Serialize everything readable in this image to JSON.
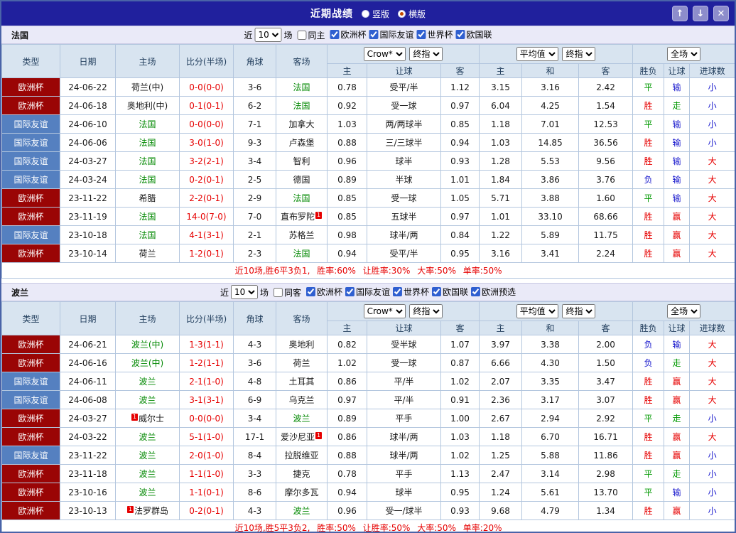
{
  "titlebar": {
    "title": "近期战绩",
    "radios": [
      {
        "label": "竖版",
        "selected": false
      },
      {
        "label": "横版",
        "selected": true
      }
    ],
    "buttons": {
      "up": "↑",
      "down": "↓",
      "close": "✕"
    }
  },
  "table": {
    "static_cols": [
      "类型",
      "日期",
      "主场",
      "比分(半场)",
      "角球",
      "客场"
    ],
    "sub_cols": [
      "主",
      "让球",
      "客",
      "主",
      "和",
      "客",
      "胜负",
      "让球",
      "进球数"
    ],
    "selects": {
      "company": "Crow*",
      "final": "终指",
      "average": "平均值",
      "final2": "终指",
      "scope": "全场"
    }
  },
  "sections": [
    {
      "team": "法国",
      "near_label": "近",
      "count": "10",
      "games_label": "场",
      "same_label": "同主",
      "competitions": [
        "欧洲杯",
        "国际友谊",
        "世界杯",
        "欧国联"
      ],
      "rows": [
        [
          "欧洲杯",
          "24-06-22",
          {
            "t": "荷兰(中)"
          },
          "0-0(0-0)",
          "3-6",
          {
            "t": "法国",
            "g": 1
          },
          "0.78",
          "受平/半",
          "1.12",
          "3.15",
          "3.16",
          "2.42",
          "平",
          "输",
          "小"
        ],
        [
          "欧洲杯",
          "24-06-18",
          {
            "t": "奥地利(中)"
          },
          "0-1(0-1)",
          "6-2",
          {
            "t": "法国",
            "g": 1
          },
          "0.92",
          "受一球",
          "0.97",
          "6.04",
          "4.25",
          "1.54",
          "胜",
          "走",
          "小"
        ],
        [
          "国际友谊",
          "24-06-10",
          {
            "t": "法国",
            "g": 1
          },
          "0-0(0-0)",
          "7-1",
          {
            "t": "加拿大"
          },
          "1.03",
          "两/两球半",
          "0.85",
          "1.18",
          "7.01",
          "12.53",
          "平",
          "输",
          "小"
        ],
        [
          "国际友谊",
          "24-06-06",
          {
            "t": "法国",
            "g": 1
          },
          "3-0(1-0)",
          "9-3",
          {
            "t": "卢森堡"
          },
          "0.88",
          "三/三球半",
          "0.94",
          "1.03",
          "14.85",
          "36.56",
          "胜",
          "输",
          "小"
        ],
        [
          "国际友谊",
          "24-03-27",
          {
            "t": "法国",
            "g": 1
          },
          "3-2(2-1)",
          "3-4",
          {
            "t": "智利"
          },
          "0.96",
          "球半",
          "0.93",
          "1.28",
          "5.53",
          "9.56",
          "胜",
          "输",
          "大"
        ],
        [
          "国际友谊",
          "24-03-24",
          {
            "t": "法国",
            "g": 1
          },
          "0-2(0-1)",
          "2-5",
          {
            "t": "德国"
          },
          "0.89",
          "半球",
          "1.01",
          "1.84",
          "3.86",
          "3.76",
          "负",
          "输",
          "大"
        ],
        [
          "欧洲杯",
          "23-11-22",
          {
            "t": "希腊"
          },
          "2-2(0-1)",
          "2-9",
          {
            "t": "法国",
            "g": 1
          },
          "0.85",
          "受一球",
          "1.05",
          "5.71",
          "3.88",
          "1.60",
          "平",
          "输",
          "大"
        ],
        [
          "欧洲杯",
          "23-11-19",
          {
            "t": "法国",
            "g": 1
          },
          "14-0(7-0)",
          "7-0",
          {
            "t": "直布罗陀",
            "b": "1"
          },
          "0.85",
          "五球半",
          "0.97",
          "1.01",
          "33.10",
          "68.66",
          "胜",
          "赢",
          "大"
        ],
        [
          "国际友谊",
          "23-10-18",
          {
            "t": "法国",
            "g": 1
          },
          "4-1(3-1)",
          "2-1",
          {
            "t": "苏格兰"
          },
          "0.98",
          "球半/两",
          "0.84",
          "1.22",
          "5.89",
          "11.75",
          "胜",
          "赢",
          "大"
        ],
        [
          "欧洲杯",
          "23-10-14",
          {
            "t": "荷兰"
          },
          "1-2(0-1)",
          "2-3",
          {
            "t": "法国",
            "g": 1
          },
          "0.94",
          "受平/半",
          "0.95",
          "3.16",
          "3.41",
          "2.24",
          "胜",
          "赢",
          "大"
        ]
      ],
      "summary": "近10场,胜6平3负1, 胜率:60% 让胜率:30% 大率:50% 单率:50%"
    },
    {
      "team": "波兰",
      "near_label": "近",
      "count": "10",
      "games_label": "场",
      "same_label": "同客",
      "competitions": [
        "欧洲杯",
        "国际友谊",
        "世界杯",
        "欧国联",
        "欧洲预选"
      ],
      "rows": [
        [
          "欧洲杯",
          "24-06-21",
          {
            "t": "波兰(中)",
            "g": 1
          },
          "1-3(1-1)",
          "4-3",
          {
            "t": "奥地利"
          },
          "0.82",
          "受半球",
          "1.07",
          "3.97",
          "3.38",
          "2.00",
          "负",
          "输",
          "大"
        ],
        [
          "欧洲杯",
          "24-06-16",
          {
            "t": "波兰(中)",
            "g": 1
          },
          "1-2(1-1)",
          "3-6",
          {
            "t": "荷兰"
          },
          "1.02",
          "受一球",
          "0.87",
          "6.66",
          "4.30",
          "1.50",
          "负",
          "走",
          "大"
        ],
        [
          "国际友谊",
          "24-06-11",
          {
            "t": "波兰",
            "g": 1
          },
          "2-1(1-0)",
          "4-8",
          {
            "t": "土耳其"
          },
          "0.86",
          "平/半",
          "1.02",
          "2.07",
          "3.35",
          "3.47",
          "胜",
          "赢",
          "大"
        ],
        [
          "国际友谊",
          "24-06-08",
          {
            "t": "波兰",
            "g": 1
          },
          "3-1(3-1)",
          "6-9",
          {
            "t": "乌克兰"
          },
          "0.97",
          "平/半",
          "0.91",
          "2.36",
          "3.17",
          "3.07",
          "胜",
          "赢",
          "大"
        ],
        [
          "欧洲杯",
          "24-03-27",
          {
            "t": "威尔士",
            "bb": "1"
          },
          "0-0(0-0)",
          "3-4",
          {
            "t": "波兰",
            "g": 1
          },
          "0.89",
          "平手",
          "1.00",
          "2.67",
          "2.94",
          "2.92",
          "平",
          "走",
          "小"
        ],
        [
          "欧洲杯",
          "24-03-22",
          {
            "t": "波兰",
            "g": 1
          },
          "5-1(1-0)",
          "17-1",
          {
            "t": "爱沙尼亚",
            "b": "1"
          },
          "0.86",
          "球半/两",
          "1.03",
          "1.18",
          "6.70",
          "16.71",
          "胜",
          "赢",
          "大"
        ],
        [
          "国际友谊",
          "23-11-22",
          {
            "t": "波兰",
            "g": 1
          },
          "2-0(1-0)",
          "8-4",
          {
            "t": "拉脱维亚"
          },
          "0.88",
          "球半/两",
          "1.02",
          "1.25",
          "5.88",
          "11.86",
          "胜",
          "赢",
          "小"
        ],
        [
          "欧洲杯",
          "23-11-18",
          {
            "t": "波兰",
            "g": 1
          },
          "1-1(1-0)",
          "3-3",
          {
            "t": "捷克"
          },
          "0.78",
          "平手",
          "1.13",
          "2.47",
          "3.14",
          "2.98",
          "平",
          "走",
          "小"
        ],
        [
          "欧洲杯",
          "23-10-16",
          {
            "t": "波兰",
            "g": 1
          },
          "1-1(0-1)",
          "8-6",
          {
            "t": "摩尔多瓦"
          },
          "0.94",
          "球半",
          "0.95",
          "1.24",
          "5.61",
          "13.70",
          "平",
          "输",
          "小"
        ],
        [
          "欧洲杯",
          "23-10-13",
          {
            "t": "法罗群岛",
            "bb": "1"
          },
          "0-2(0-1)",
          "4-3",
          {
            "t": "波兰",
            "g": 1
          },
          "0.96",
          "受一/球半",
          "0.93",
          "9.68",
          "4.79",
          "1.34",
          "胜",
          "赢",
          "小"
        ]
      ],
      "summary": "近10场,胜5平3负2, 胜率:50% 让胜率:50% 大率:50% 单率:20%"
    }
  ]
}
